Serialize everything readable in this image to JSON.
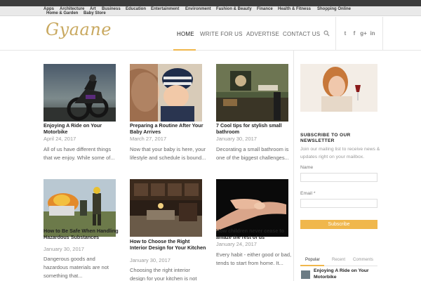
{
  "categories": [
    "Apps",
    "Architecture",
    "Art",
    "Business",
    "Education",
    "Entertainment",
    "Environment",
    "Fashion & Beauty",
    "Finance",
    "Health & Fitness",
    "Shopping Online",
    "Home & Garden",
    "Baby Store"
  ],
  "site": {
    "logo": "Gyaane"
  },
  "nav": [
    "HOME",
    "WRITE FOR US",
    "ADVERTISE",
    "CONTACT US"
  ],
  "social_icons": [
    "twitter-icon",
    "facebook-icon",
    "google-plus-icon",
    "linkedin-icon"
  ],
  "posts": [
    {
      "title": "Enjoying A Ride on Your Motorbike",
      "date": "April 24, 2017",
      "excerpt": "All of us have different things that we enjoy. While some of..."
    },
    {
      "title": "Preparing a Routine After Your Baby Arrives",
      "date": "March 27, 2017",
      "excerpt": "Now that your baby is here, your lifestyle and schedule is bound..."
    },
    {
      "title": "7 Cool tips for stylish small bathroom",
      "date": "January 30, 2017",
      "excerpt": "Decorating a small bathroom is one of the biggest challenges..."
    },
    {
      "title": "How to Be Safe When Handling Hazardous Substances",
      "date": "January 30, 2017",
      "excerpt": "Dangerous goods and hazardous materials are not something that..."
    },
    {
      "title": "How to Choose the Right Interior Design for Your Kitchen",
      "date": "January 30, 2017",
      "excerpt": "Choosing the right interior design for your kitchen is not"
    },
    {
      "title": "How children never cease to amaze the rest of us",
      "date": "January 24, 2017",
      "excerpt": "Every habit - either good or bad, tends to start from home. It..."
    }
  ],
  "sidebar": {
    "newsletter_heading": "SUBSCRIBE TO OUR NEWSLETTER",
    "newsletter_text": "Join our mailing list to receive news & updates right on your mailbox.",
    "name_label": "Name",
    "email_label": "Email *",
    "subscribe_label": "Subscribe",
    "tabs": [
      "Popular",
      "Recent",
      "Comments"
    ],
    "popular_post_title": "Enjoying A Ride on Your Motorbike"
  },
  "colors": {
    "accent": "#f0b74c",
    "logo": "#c9a960"
  }
}
